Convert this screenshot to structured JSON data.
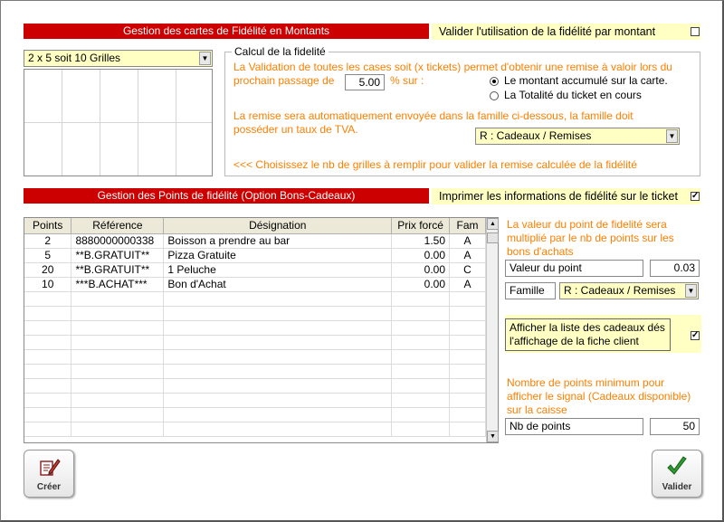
{
  "section1": {
    "title": "Gestion des cartes de Fidélité en Montants",
    "validate_label": "Valider l'utilisation de la fidélité par montant",
    "validate_checked": false,
    "grid_select": "2 x 5   soit 10 Grilles",
    "group_title": "Calcul de la fidelité",
    "text1_line1": "La Validation de toutes les cases soit (x tickets) permet d'obtenir une remise à valoir lors du",
    "text1_line2": "prochain passage de",
    "amount": "5.00",
    "percent_on": "% sur :",
    "radio1": "Le montant accumulé sur la carte.",
    "radio2": "La Totalité du ticket en cours",
    "text2_line1": "La remise sera automatiquement envoyée dans la famille ci-dessous, la famille doit",
    "text2_line2": "posséder un taux de TVA.",
    "family_select": "R : Cadeaux / Remises",
    "hint": "<<< Choisissez le nb de grilles à remplir pour valider la remise calculée de la fidélité"
  },
  "section2": {
    "title": "Gestion des Points de fidélité  (Option Bons-Cadeaux)",
    "print_label": "Imprimer les informations de fidélité sur le ticket",
    "print_checked": "✓",
    "columns": [
      "Points",
      "Référence",
      "Désignation",
      "Prix forcé",
      "Fam"
    ],
    "rows": [
      [
        "2",
        "8880000000338",
        "Boisson a prendre au bar",
        "1.50",
        "A"
      ],
      [
        "5",
        "**B.GRATUIT**",
        "Pizza Gratuite",
        "0.00",
        "A"
      ],
      [
        "20",
        "**B.GRATUIT**",
        "1 Peluche",
        "0.00",
        "C"
      ],
      [
        "10",
        "***B.ACHAT***",
        "Bon d'Achat",
        "0.00",
        "A"
      ]
    ],
    "info1_line1": "La valeur du point de fidelité sera",
    "info1_line2": "multiplié par le nb de points sur les",
    "info1_line3": "bons d'achats",
    "point_value_label": "Valeur du point",
    "point_value": "0.03",
    "family_label": "Famille",
    "family_value": "R : Cadeaux / Remises",
    "show_list_line1": "Afficher la liste des cadeaux dés",
    "show_list_line2": "l'affichage de la fiche client",
    "show_list_checked": "✓",
    "min_line1": "Nombre de points minimum  pour",
    "min_line2": "afficher le signal (Cadeaux disponible)",
    "min_line3": "sur la caisse",
    "nb_points_label": "Nb de points",
    "nb_points": "50"
  },
  "buttons": {
    "create": "Créer",
    "validate": "Valider"
  },
  "icons": {
    "create": "edit-pencil-icon",
    "validate": "checkmark-icon"
  },
  "colors": {
    "header_red": "#cc0000",
    "highlight_yellow": "#ffffc4",
    "info_orange": "#ff7f00",
    "check_green": "#2e9b2e"
  }
}
